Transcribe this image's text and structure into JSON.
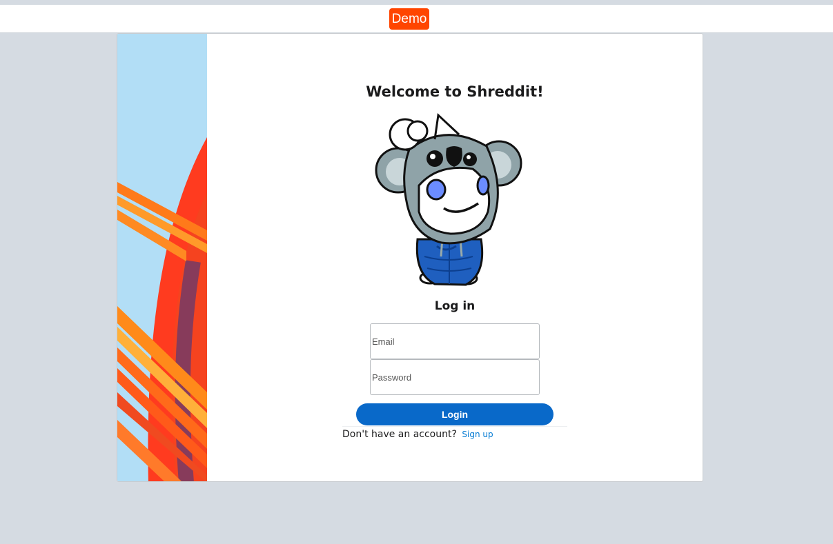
{
  "navbar": {
    "demo_label": "Demo"
  },
  "login": {
    "title": "Welcome to Shreddit!",
    "heading": "Log in",
    "email_placeholder": "Email",
    "password_placeholder": "Password",
    "submit_label": "Login",
    "no_account_text": "Don't have an account?",
    "signup_label": "Sign up"
  },
  "colors": {
    "accent": "#ff4500",
    "button": "#0969c9",
    "link": "#0079d3",
    "background": "#d5dbe2"
  },
  "icons": {
    "mascot": "koala-snoo-mascot",
    "side_art": "abstract-orange-stripes-art"
  }
}
